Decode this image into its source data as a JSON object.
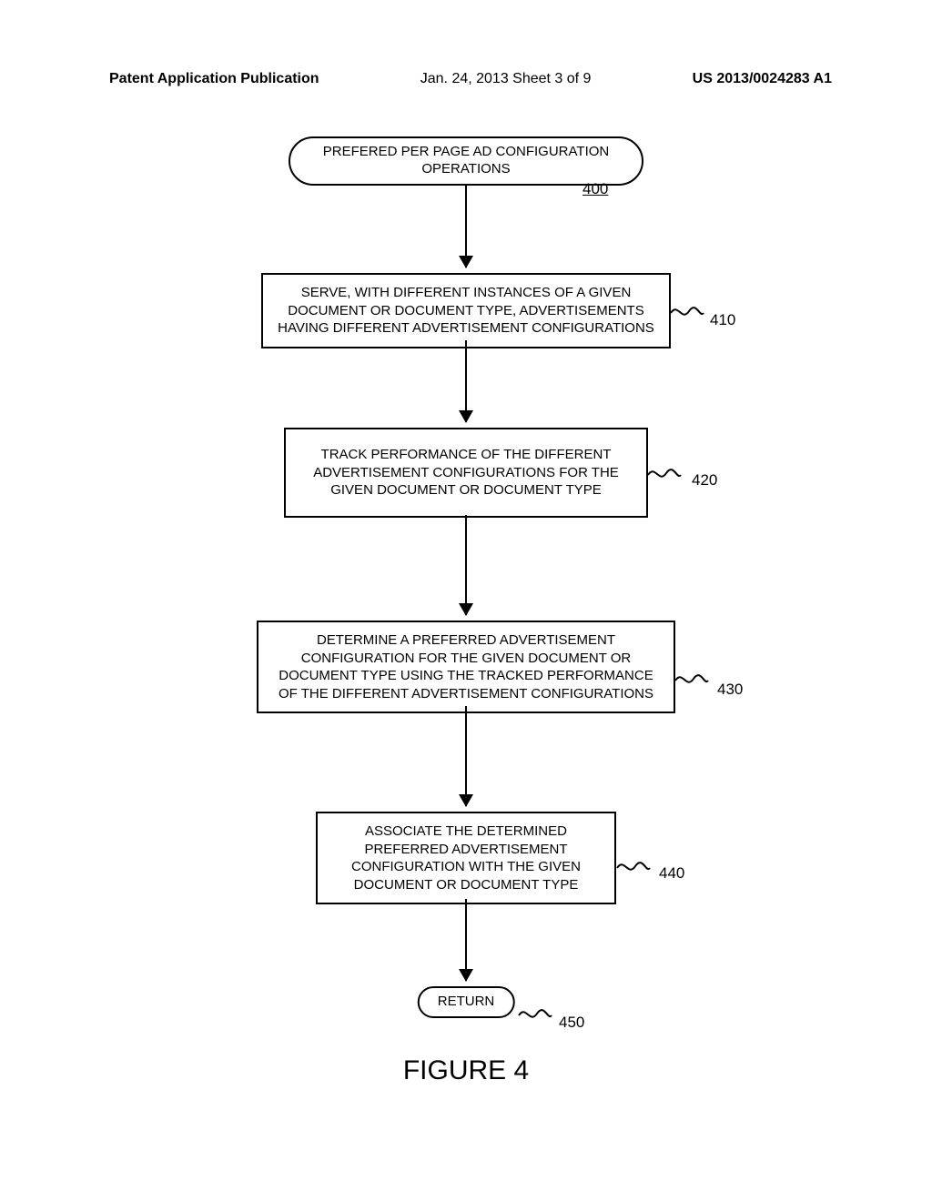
{
  "header": {
    "left": "Patent Application Publication",
    "mid": "Jan. 24, 2013  Sheet 3 of 9",
    "right": "US 2013/0024283 A1"
  },
  "flow": {
    "start": {
      "title_line1": "PREFERED PER PAGE AD CONFIGURATION",
      "title_line2": "OPERATIONS",
      "ref": "400"
    },
    "steps": [
      {
        "text": "SERVE, WITH DIFFERENT INSTANCES OF A GIVEN DOCUMENT OR DOCUMENT TYPE, ADVERTISEMENTS HAVING DIFFERENT ADVERTISEMENT CONFIGURATIONS",
        "ref": "410"
      },
      {
        "text": "TRACK PERFORMANCE OF THE DIFFERENT ADVERTISEMENT CONFIGURATIONS FOR THE GIVEN DOCUMENT OR DOCUMENT TYPE",
        "ref": "420"
      },
      {
        "text": "DETERMINE A PREFERRED ADVERTISEMENT CONFIGURATION FOR THE GIVEN DOCUMENT OR DOCUMENT TYPE USING THE TRACKED PERFORMANCE OF THE DIFFERENT ADVERTISEMENT CONFIGURATIONS",
        "ref": "430"
      },
      {
        "text": "ASSOCIATE THE DETERMINED PREFERRED ADVERTISEMENT CONFIGURATION WITH THE GIVEN DOCUMENT OR DOCUMENT TYPE",
        "ref": "440"
      }
    ],
    "end": {
      "label": "RETURN",
      "ref": "450"
    }
  },
  "caption": "FIGURE 4"
}
